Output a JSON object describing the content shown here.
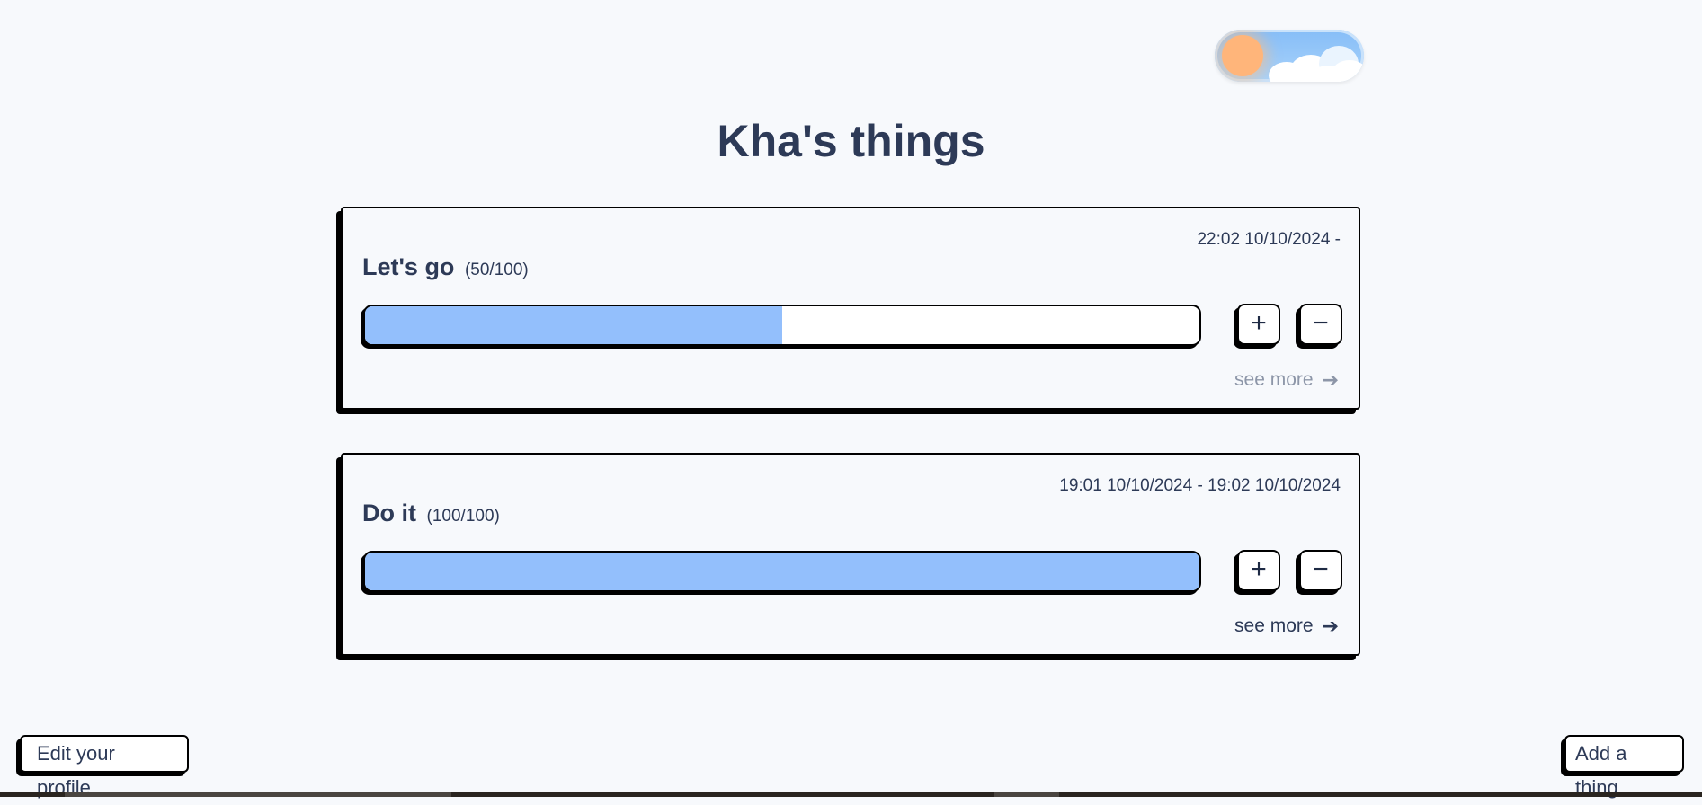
{
  "page": {
    "title": "Kha's things"
  },
  "theme_toggle": {
    "mode": "light",
    "icon": "sun-icon"
  },
  "things": [
    {
      "name": "Let's go",
      "count": "(50/100)",
      "dates": "22:02 10/10/2024 -",
      "progress": 0.5,
      "plus_label": "+",
      "minus_label": "−",
      "see_more_label": "see more",
      "see_more_icon": "arrow-right-icon",
      "see_more_enabled": false
    },
    {
      "name": "Do it",
      "count": "(100/100)",
      "dates": "19:01 10/10/2024 - 19:02 10/10/2024",
      "progress": 1.0,
      "plus_label": "+",
      "minus_label": "−",
      "see_more_label": "see more",
      "see_more_icon": "arrow-right-icon",
      "see_more_enabled": true
    }
  ],
  "footer": {
    "edit_profile_label": "Edit your profile",
    "add_thing_label": "Add a thing"
  },
  "colors": {
    "text": "#2d3a57",
    "background": "#f7f9fc",
    "progress_fill": "#93bffc",
    "muted_link": "#8d96a8"
  }
}
